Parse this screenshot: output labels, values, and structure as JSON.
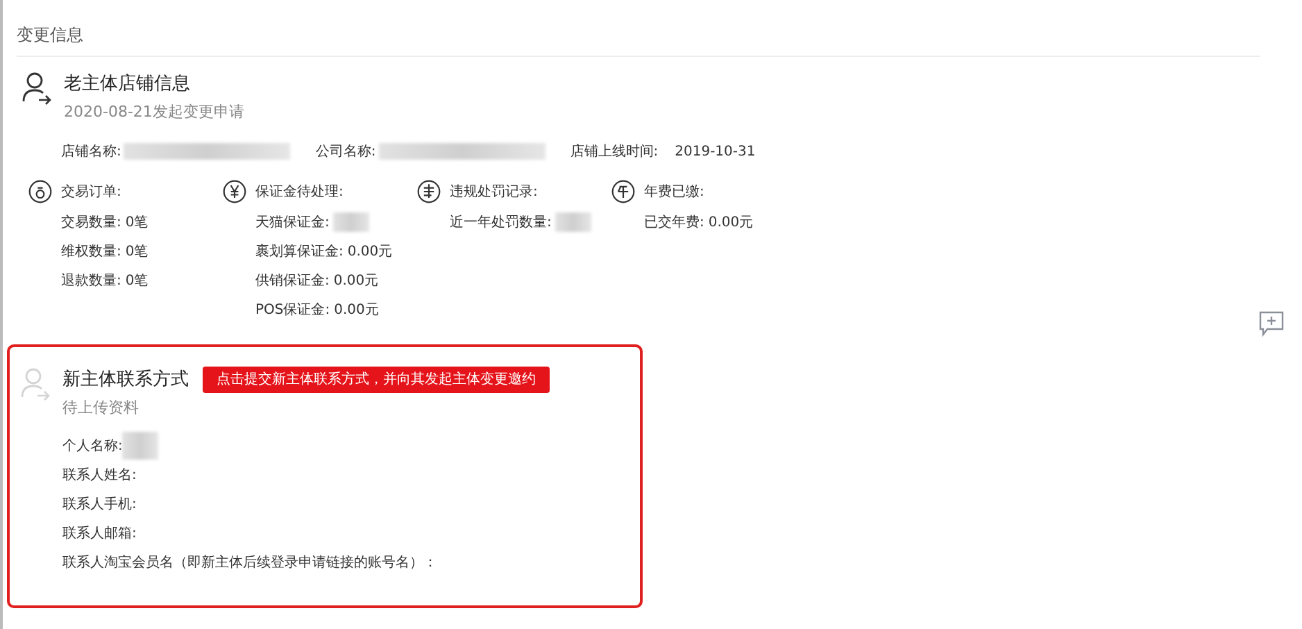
{
  "page_title": "变更信息",
  "old_entity": {
    "title": "老主体店铺信息",
    "subtitle": "2020-08-21发起变更申请",
    "info": [
      {
        "label": "店铺名称:",
        "redacted": true
      },
      {
        "label": "公司名称:",
        "redacted": true
      },
      {
        "label": "店铺上线时间:",
        "value": "2019-10-31",
        "redacted": false
      }
    ],
    "stats": [
      {
        "kind": "orders",
        "heading": "交易订单:",
        "rows": [
          {
            "label": "交易数量:",
            "value": "0笔",
            "redacted": false
          },
          {
            "label": "维权数量:",
            "value": "0笔",
            "redacted": false
          },
          {
            "label": "退款数量:",
            "value": "0笔",
            "redacted": false
          }
        ]
      },
      {
        "kind": "deposit",
        "heading": "保证金待处理:",
        "rows": [
          {
            "label": "天猫保证金:",
            "redacted": true
          },
          {
            "label": "裹划算保证金:",
            "value": "0.00元",
            "redacted": false
          },
          {
            "label": "供销保证金:",
            "value": "0.00元",
            "redacted": false
          },
          {
            "label": "POS保证金:",
            "value": "0.00元",
            "redacted": false
          }
        ]
      },
      {
        "kind": "penalty",
        "heading": "违规处罚记录:",
        "rows": [
          {
            "label": "近一年处罚数量:",
            "redacted": true
          }
        ]
      },
      {
        "kind": "annual",
        "heading": "年费已缴:",
        "rows": [
          {
            "label": "已交年费:",
            "value": "0.00元",
            "redacted": false
          }
        ]
      }
    ]
  },
  "new_entity": {
    "title": "新主体联系方式",
    "banner": "点击提交新主体联系方式，并向其发起主体变更邀约",
    "subtitle": "待上传资料",
    "fields": [
      {
        "label": "个人名称:",
        "redacted": true
      },
      {
        "label": "联系人姓名:",
        "redacted": false
      },
      {
        "label": "联系人手机:",
        "redacted": false
      },
      {
        "label": "联系人邮箱:",
        "redacted": false
      },
      {
        "label": "联系人淘宝会员名（即新主体后续登录申请链接的账号名）：",
        "redacted": false
      }
    ]
  }
}
